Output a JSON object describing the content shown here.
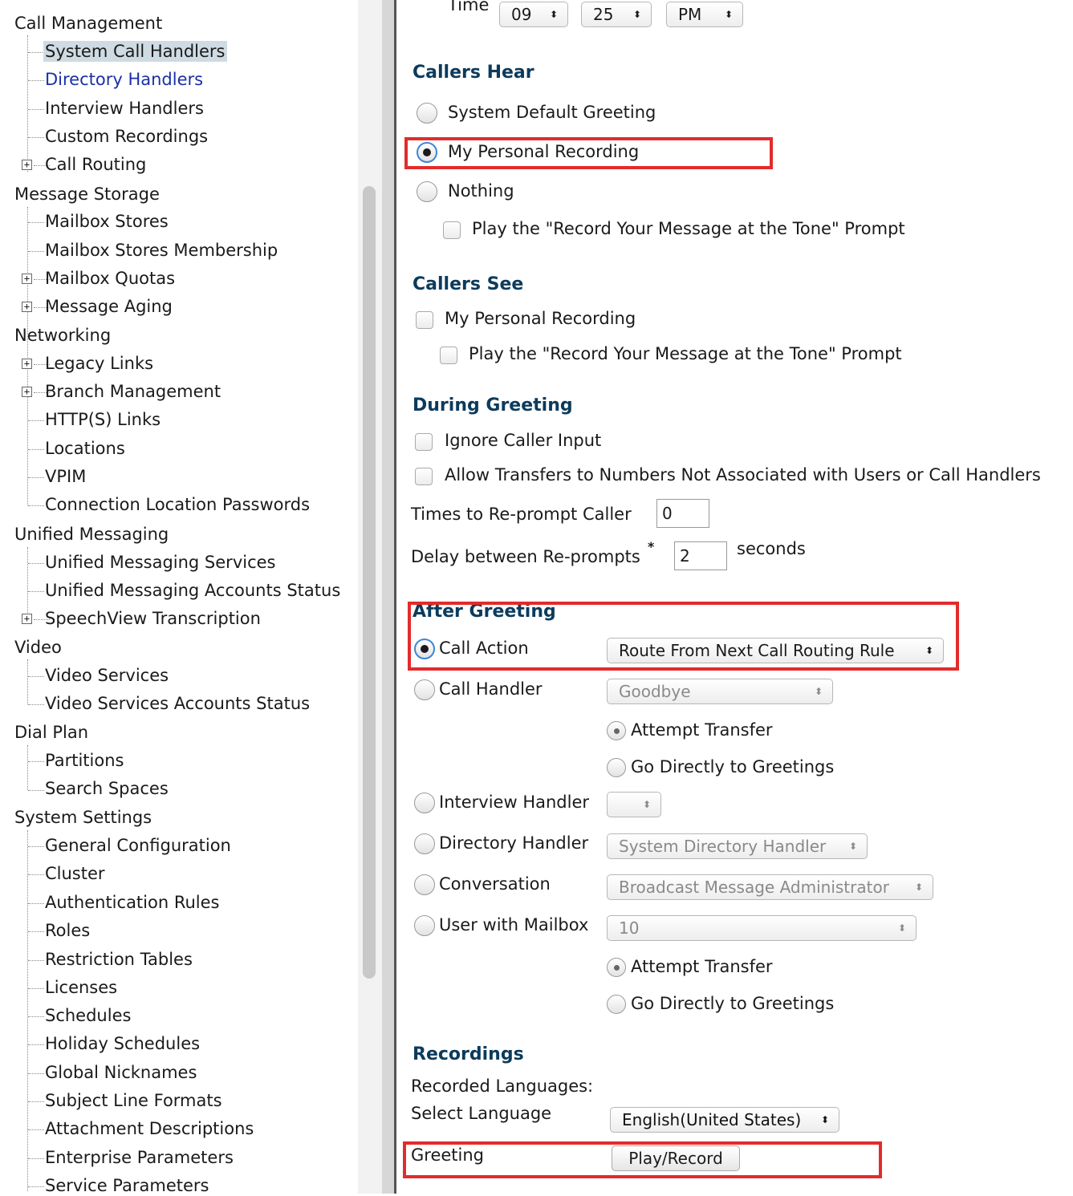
{
  "nav": {
    "sections": {
      "call_management": "Call Management",
      "message_storage": "Message Storage",
      "networking": "Networking",
      "unified_messaging": "Unified Messaging",
      "video": "Video",
      "dial_plan": "Dial Plan",
      "system_settings": "System Settings"
    },
    "items": {
      "system_call_handlers": "System Call Handlers",
      "directory_handlers": "Directory Handlers",
      "interview_handlers": "Interview Handlers",
      "custom_recordings": "Custom Recordings",
      "call_routing": "Call Routing",
      "mailbox_stores": "Mailbox Stores",
      "mailbox_stores_membership": "Mailbox Stores Membership",
      "mailbox_quotas": "Mailbox Quotas",
      "message_aging": "Message Aging",
      "legacy_links": "Legacy Links",
      "branch_management": "Branch Management",
      "https_links": "HTTP(S) Links",
      "locations": "Locations",
      "vpim": "VPIM",
      "connection_location_passwords": "Connection Location Passwords",
      "unified_messaging_services": "Unified Messaging Services",
      "unified_messaging_accounts_status": "Unified Messaging Accounts Status",
      "speechview_transcription": "SpeechView Transcription",
      "video_services": "Video Services",
      "video_services_accounts_status": "Video Services Accounts Status",
      "partitions": "Partitions",
      "search_spaces": "Search Spaces",
      "general_configuration": "General Configuration",
      "cluster": "Cluster",
      "authentication_rules": "Authentication Rules",
      "roles": "Roles",
      "restriction_tables": "Restriction Tables",
      "licenses": "Licenses",
      "schedules": "Schedules",
      "holiday_schedules": "Holiday Schedules",
      "global_nicknames": "Global Nicknames",
      "subject_line_formats": "Subject Line Formats",
      "attachment_descriptions": "Attachment Descriptions",
      "enterprise_parameters": "Enterprise Parameters",
      "service_parameters": "Service Parameters"
    },
    "expander_glyph": "+"
  },
  "form": {
    "time": {
      "label": "Time",
      "hour": "09",
      "minute": "25",
      "ampm": "PM"
    },
    "select_arrow": "⬍",
    "callers_hear": {
      "title": "Callers Hear",
      "system_default": "System Default Greeting",
      "personal_recording": "My Personal Recording",
      "nothing": "Nothing",
      "play_prompt": "Play the \"Record Your Message at the Tone\" Prompt",
      "selected": "My Personal Recording"
    },
    "callers_see": {
      "title": "Callers See",
      "personal_recording": "My Personal Recording",
      "play_prompt": "Play the \"Record Your Message at the Tone\" Prompt"
    },
    "during_greeting": {
      "title": "During Greeting",
      "ignore_input": "Ignore Caller Input",
      "allow_transfers": "Allow Transfers to Numbers Not Associated with Users or Call Handlers",
      "reprompt_label": "Times to Re-prompt Caller",
      "reprompt_value": "0",
      "delay_label": "Delay between Re-prompts",
      "required_mark": "*",
      "delay_value": "2",
      "seconds": "seconds"
    },
    "after_greeting": {
      "title": "After Greeting",
      "call_action": "Call Action",
      "call_action_value": "Route From Next Call Routing Rule",
      "call_handler": "Call Handler",
      "call_handler_value": "Goodbye",
      "attempt_transfer": "Attempt Transfer",
      "go_directly": "Go Directly to Greetings",
      "interview_handler": "Interview Handler",
      "interview_handler_value": "",
      "directory_handler": "Directory Handler",
      "directory_handler_value": "System Directory Handler",
      "conversation": "Conversation",
      "conversation_value": "Broadcast Message Administrator",
      "user_with_mailbox": "User with Mailbox",
      "user_with_mailbox_value": "10",
      "selected": "Call Action"
    },
    "recordings": {
      "title": "Recordings",
      "recorded_languages": "Recorded Languages:",
      "select_language": "Select Language",
      "language_value": "English(United States)",
      "greeting": "Greeting",
      "play_record": "Play/Record"
    },
    "highlight_color": "#e32b2b",
    "section_color": "#0c3b5c",
    "link_color": "#1b2fa8"
  }
}
